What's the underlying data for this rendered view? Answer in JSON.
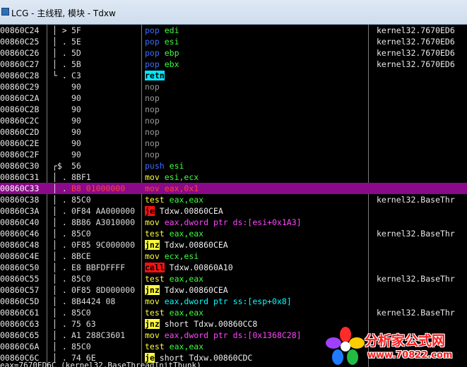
{
  "window": {
    "title": "LCG - 主线程, 模块 - Tdxw"
  },
  "rows": [
    {
      "addr": "00860C24",
      "marker": "│ >",
      "hex": "5F",
      "mn": "pop",
      "mc": "m-blue",
      "op": "edi",
      "oc": "o-green",
      "cmt": "kernel32.7670ED6"
    },
    {
      "addr": "00860C25",
      "marker": "│ .",
      "hex": "5E",
      "mn": "pop",
      "mc": "m-blue",
      "op": "esi",
      "oc": "o-green",
      "cmt": "kernel32.7670ED6"
    },
    {
      "addr": "00860C26",
      "marker": "│ .",
      "hex": "5D",
      "mn": "pop",
      "mc": "m-blue",
      "op": "ebp",
      "oc": "o-green",
      "cmt": "kernel32.7670ED6"
    },
    {
      "addr": "00860C27",
      "marker": "│ .",
      "hex": "5B",
      "mn": "pop",
      "mc": "m-blue",
      "op": "ebx",
      "oc": "o-green",
      "cmt": "kernel32.7670ED6"
    },
    {
      "addr": "00860C28",
      "marker": "└ .",
      "hex": "C3",
      "mn": "retn",
      "mc": "m-cyan-bg",
      "op": "",
      "oc": "",
      "cmt": ""
    },
    {
      "addr": "00860C29",
      "marker": "",
      "hex": "90",
      "mn": "nop",
      "mc": "m-gray",
      "op": "",
      "oc": "",
      "cmt": ""
    },
    {
      "addr": "00860C2A",
      "marker": "",
      "hex": "90",
      "mn": "nop",
      "mc": "m-gray",
      "op": "",
      "oc": "",
      "cmt": ""
    },
    {
      "addr": "00860C2B",
      "marker": "",
      "hex": "90",
      "mn": "nop",
      "mc": "m-gray",
      "op": "",
      "oc": "",
      "cmt": ""
    },
    {
      "addr": "00860C2C",
      "marker": "",
      "hex": "90",
      "mn": "nop",
      "mc": "m-gray",
      "op": "",
      "oc": "",
      "cmt": ""
    },
    {
      "addr": "00860C2D",
      "marker": "",
      "hex": "90",
      "mn": "nop",
      "mc": "m-gray",
      "op": "",
      "oc": "",
      "cmt": ""
    },
    {
      "addr": "00860C2E",
      "marker": "",
      "hex": "90",
      "mn": "nop",
      "mc": "m-gray",
      "op": "",
      "oc": "",
      "cmt": ""
    },
    {
      "addr": "00860C2F",
      "marker": "",
      "hex": "90",
      "mn": "nop",
      "mc": "m-gray",
      "op": "",
      "oc": "",
      "cmt": ""
    },
    {
      "addr": "00860C30",
      "marker": "┌$",
      "hex": "56",
      "mn": "push",
      "mc": "m-blue",
      "op": "esi",
      "oc": "o-green",
      "cmt": ""
    },
    {
      "addr": "00860C31",
      "marker": "│ .",
      "hex": "8BF1",
      "mn": "mov",
      "mc": "m-yellow",
      "op": "esi,ecx",
      "oc": "o-green",
      "cmt": ""
    },
    {
      "addr": "00860C33",
      "marker": "│ .",
      "hex": "B8 01000000",
      "mn": "mov",
      "mc": "m-red",
      "op": "eax,0x1",
      "oc": "o-red",
      "cmt": "",
      "selected": true
    },
    {
      "addr": "00860C38",
      "marker": "│ .",
      "hex": "85C0",
      "mn": "test",
      "mc": "m-yellow",
      "op": "eax,eax",
      "oc": "o-green",
      "cmt": "kernel32.BaseThr"
    },
    {
      "addr": "00860C3A",
      "marker": "│ .v",
      "hex": "0F84 AA000000",
      "mn": "je",
      "mc": "m-red-bg",
      "op": "Tdxw.00860CEA",
      "oc": "o-white",
      "cmt": ""
    },
    {
      "addr": "00860C40",
      "marker": "│ .",
      "hex": "8B86 A3010000",
      "mn": "mov",
      "mc": "m-yellow",
      "op": "eax,dword ptr ds:[esi+0x1A3]",
      "oc": "o-mag",
      "cmt": ""
    },
    {
      "addr": "00860C46",
      "marker": "│ .",
      "hex": "85C0",
      "mn": "test",
      "mc": "m-yellow",
      "op": "eax,eax",
      "oc": "o-green",
      "cmt": "kernel32.BaseThr"
    },
    {
      "addr": "00860C48",
      "marker": "│ .v",
      "hex": "0F85 9C000000",
      "mn": "jnz",
      "mc": "m-yellow-bg",
      "op": "Tdxw.00860CEA",
      "oc": "o-white",
      "cmt": ""
    },
    {
      "addr": "00860C4E",
      "marker": "│ .",
      "hex": "8BCE",
      "mn": "mov",
      "mc": "m-yellow",
      "op": "ecx,esi",
      "oc": "o-green",
      "cmt": ""
    },
    {
      "addr": "00860C50",
      "marker": "│ .",
      "hex": "E8 BBFDFFFF",
      "mn": "call",
      "mc": "m-red-bg",
      "op": "Tdxw.00860A10",
      "oc": "o-white",
      "cmt": ""
    },
    {
      "addr": "00860C55",
      "marker": "│ .",
      "hex": "85C0",
      "mn": "test",
      "mc": "m-yellow",
      "op": "eax,eax",
      "oc": "o-green",
      "cmt": "kernel32.BaseThr"
    },
    {
      "addr": "00860C57",
      "marker": "│ .v",
      "hex": "0F85 8D000000",
      "mn": "jnz",
      "mc": "m-yellow-bg",
      "op": "Tdxw.00860CEA",
      "oc": "o-white",
      "cmt": ""
    },
    {
      "addr": "00860C5D",
      "marker": "│ .",
      "hex": "8B4424 08",
      "mn": "mov",
      "mc": "m-yellow",
      "op": "eax,dword ptr ss:[esp+0x8]",
      "oc": "o-cyan",
      "cmt": ""
    },
    {
      "addr": "00860C61",
      "marker": "│ .",
      "hex": "85C0",
      "mn": "test",
      "mc": "m-yellow",
      "op": "eax,eax",
      "oc": "o-green",
      "cmt": "kernel32.BaseThr"
    },
    {
      "addr": "00860C63",
      "marker": "│ .v",
      "hex": "75 63",
      "mn": "jnz",
      "mc": "m-yellow-bg",
      "op": "short Tdxw.00860CC8",
      "oc": "o-white",
      "cmt": ""
    },
    {
      "addr": "00860C65",
      "marker": "│ .",
      "hex": "A1 288C3601",
      "mn": "mov",
      "mc": "m-yellow",
      "op": "eax,dword ptr ds:[0x1368C28]",
      "oc": "o-mag",
      "cmt": ""
    },
    {
      "addr": "00860C6A",
      "marker": "│ .",
      "hex": "85C0",
      "mn": "test",
      "mc": "m-yellow",
      "op": "eax,eax",
      "oc": "o-green",
      "cmt": ""
    },
    {
      "addr": "00860C6C",
      "marker": "│ .v",
      "hex": "74 6E",
      "mn": "je",
      "mc": "m-yellow-bg",
      "op": "short Tdxw.00860CDC",
      "oc": "o-white",
      "cmt": ""
    }
  ],
  "status": "eax=7670ED6C (kernel32.BaseThreadInitThunk)",
  "watermark": {
    "line1": "分析家公式网",
    "line2": "www.70822.com"
  }
}
